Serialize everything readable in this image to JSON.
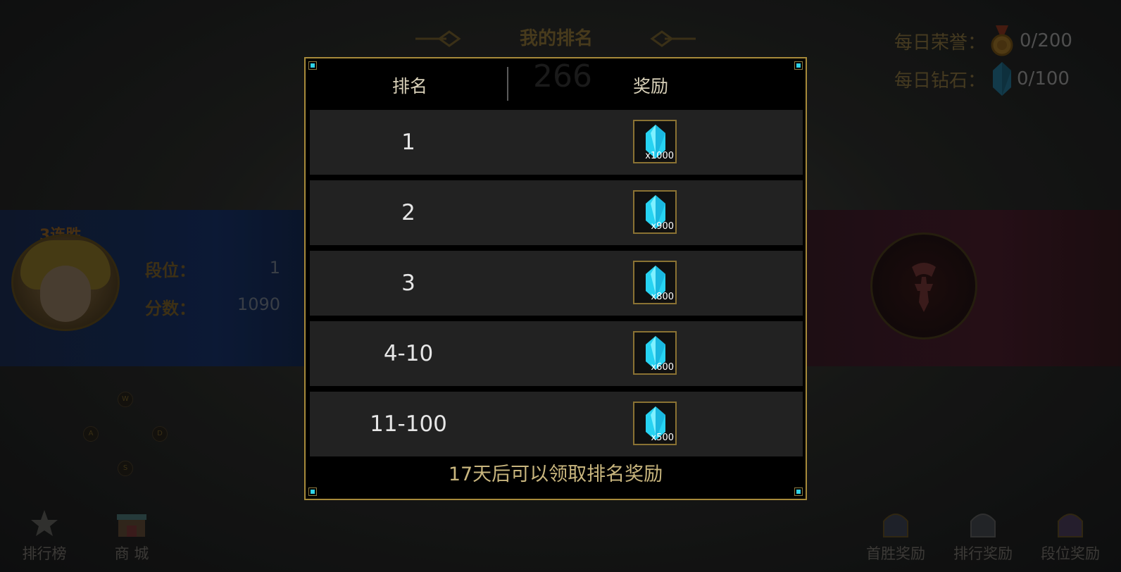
{
  "background": {
    "title": "我的排名",
    "daily_honor_label": "每日荣誉：",
    "daily_honor_value": "0/200",
    "daily_gem_label": "每日钻石：",
    "daily_gem_value": "0/100",
    "streak": "3连胜",
    "rank_label": "段位：",
    "rank_value": "1",
    "score_label": "分数：",
    "score_value": "1090",
    "ghost_rank": "266",
    "keys": [
      "W",
      "A",
      "D",
      "S"
    ],
    "bottom_left": [
      "排行榜",
      "商 城"
    ],
    "bottom_right": [
      "首胜奖励",
      "排行奖励",
      "段位奖励"
    ]
  },
  "modal": {
    "header_rank": "排名",
    "header_reward": "奖励",
    "rows": [
      {
        "rank": "1",
        "reward_icon": "diamond-icon",
        "qty": "x1000"
      },
      {
        "rank": "2",
        "reward_icon": "diamond-icon",
        "qty": "x900"
      },
      {
        "rank": "3",
        "reward_icon": "diamond-icon",
        "qty": "x800"
      },
      {
        "rank": "4-10",
        "reward_icon": "diamond-icon",
        "qty": "x600"
      },
      {
        "rank": "11-100",
        "reward_icon": "diamond-icon",
        "qty": "x500"
      }
    ],
    "footer": "17天后可以领取排名奖励"
  },
  "colors": {
    "frame_gold": "#a78a3a",
    "diamond": "#27d3f2",
    "corner_accent": "#2fd2e6",
    "footer_text": "#c9b67e"
  }
}
